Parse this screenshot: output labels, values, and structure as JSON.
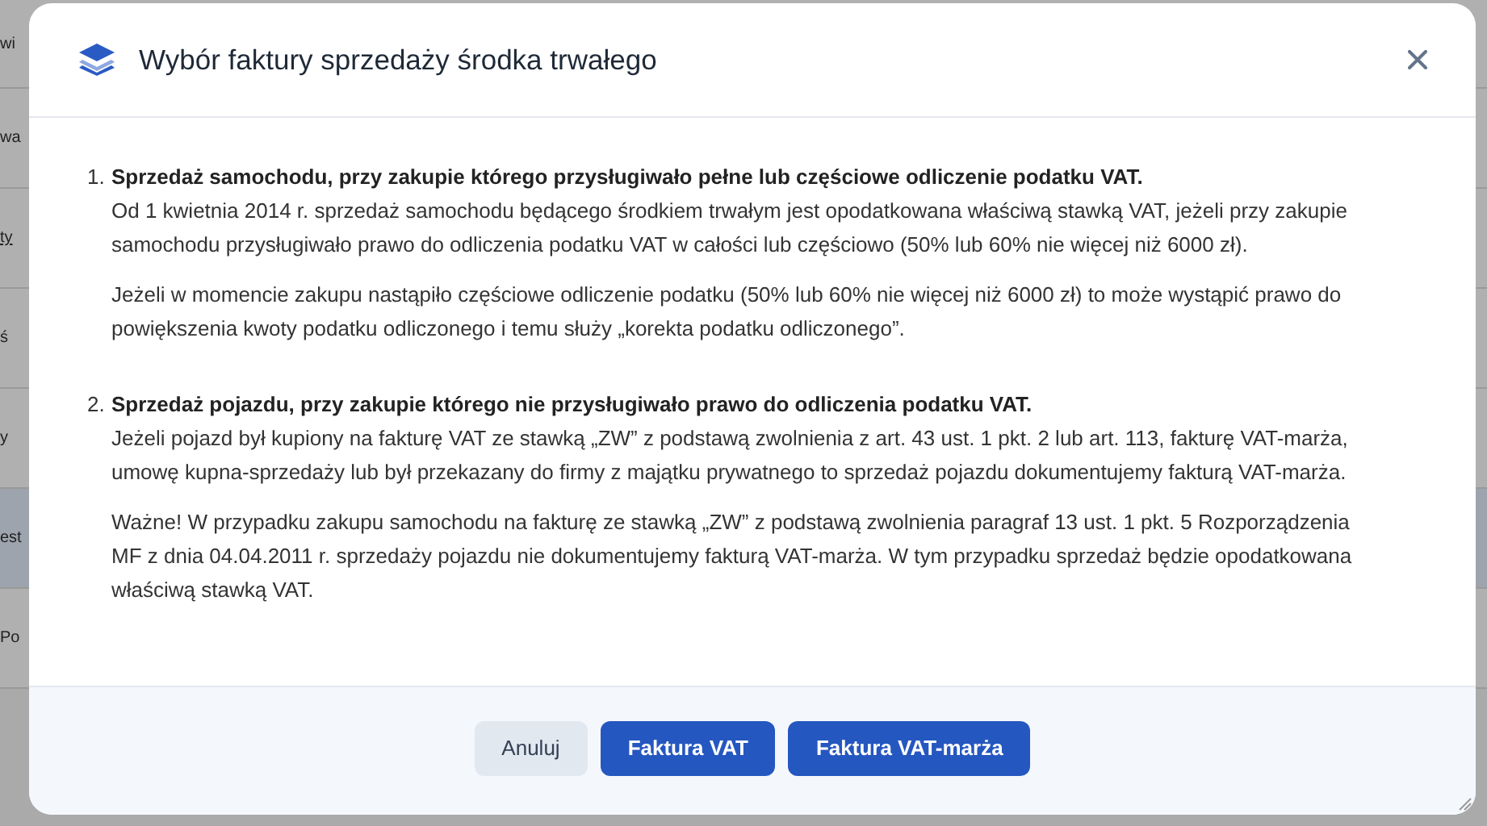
{
  "background_rows": [
    {
      "text": "wi",
      "link": false,
      "selected": false
    },
    {
      "text": "wa",
      "link": false,
      "selected": false
    },
    {
      "text": "ty",
      "link": true,
      "selected": false
    },
    {
      "text": "ś",
      "link": false,
      "selected": false
    },
    {
      "text": "y",
      "link": false,
      "selected": false
    },
    {
      "text": "est",
      "link": false,
      "selected": true
    },
    {
      "text": "Po",
      "link": false,
      "selected": false
    }
  ],
  "dialog": {
    "title": "Wybór faktury sprzedaży środka trwałego",
    "sections": [
      {
        "number": "1.",
        "heading": "Sprzedaż samochodu, przy zakupie którego przysługiwało pełne lub częściowe odliczenie podatku VAT.",
        "paragraphs": [
          "Od 1 kwietnia 2014 r. sprzedaż samochodu będącego środkiem trwałym jest opodatkowana właściwą stawką VAT, jeżeli przy zakupie samochodu przysługiwało prawo do odliczenia podatku VAT w całości lub częściowo (50% lub 60% nie więcej niż 6000 zł).",
          "Jeżeli w momencie zakupu nastąpiło częściowe odliczenie podatku (50% lub 60% nie więcej niż 6000 zł) to może wystąpić prawo do powiększenia kwoty podatku odliczonego i temu służy „korekta podatku odliczonego”."
        ]
      },
      {
        "number": "2.",
        "heading": "Sprzedaż pojazdu, przy zakupie którego nie przysługiwało prawo do odliczenia podatku VAT.",
        "paragraphs": [
          "Jeżeli pojazd był kupiony na fakturę VAT ze stawką „ZW” z podstawą zwolnienia z art. 43 ust. 1 pkt. 2 lub art. 113, fakturę VAT-marża, umowę kupna-sprzedaży lub był przekazany do firmy z majątku prywatnego to sprzedaż pojazdu dokumentujemy fakturą VAT-marża.",
          "Ważne! W przypadku zakupu samochodu na fakturę ze stawką „ZW” z podstawą zwolnienia paragraf 13 ust. 1 pkt. 5 Rozporządzenia MF z dnia 04.04.2011 r. sprzedaży pojazdu nie dokumentujemy fakturą VAT-marża. W tym przypadku sprzedaż będzie opodatkowana właściwą stawką VAT."
        ]
      }
    ],
    "buttons": [
      {
        "label": "Anuluj",
        "kind": "secondary"
      },
      {
        "label": "Faktura VAT",
        "kind": "primary"
      },
      {
        "label": "Faktura VAT-marża",
        "kind": "primary"
      }
    ]
  }
}
